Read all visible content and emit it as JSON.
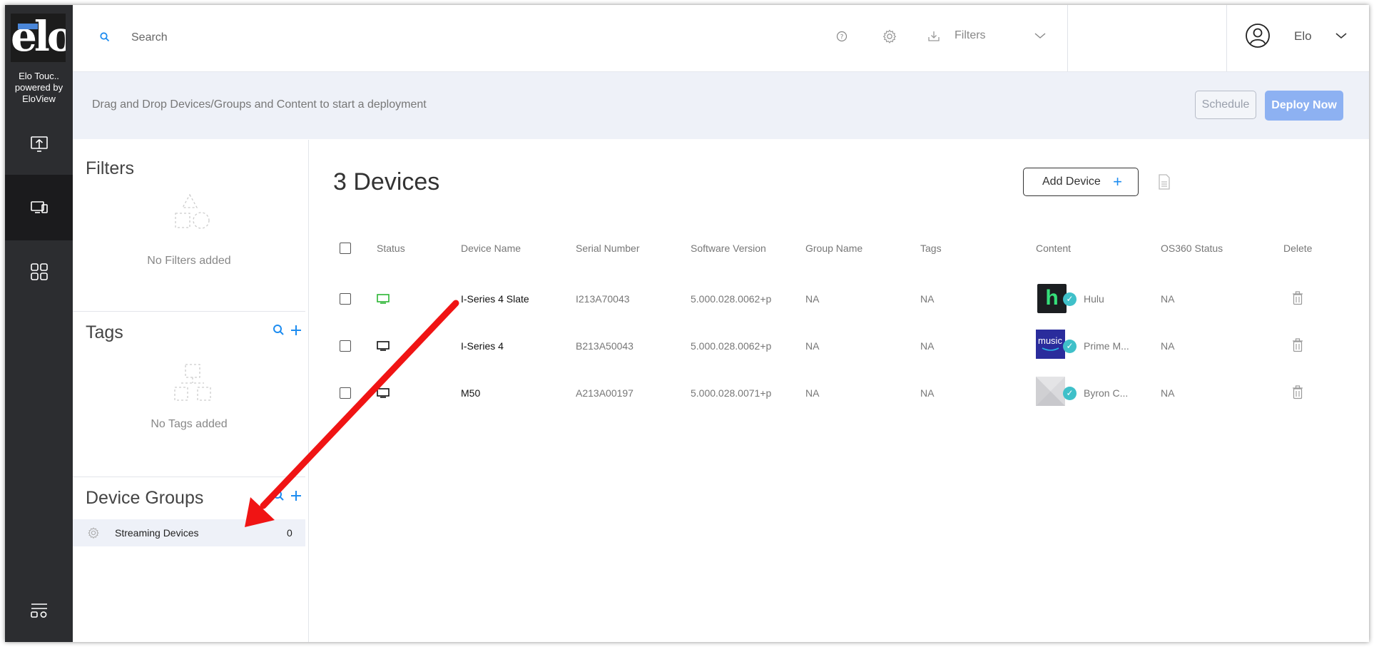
{
  "sidebar": {
    "logo_text": "elo",
    "org_name_line1": "Elo Touc..",
    "org_name_line2": "powered by",
    "org_name_line3": "EloView",
    "items": [
      {
        "icon": "upload-screen-icon"
      },
      {
        "icon": "devices-icon",
        "active": true
      },
      {
        "icon": "apps-grid-icon"
      },
      {
        "icon": "menu-settings-icon"
      }
    ]
  },
  "header": {
    "search_placeholder": "Search",
    "filters_label": "Filters",
    "user_name": "Elo"
  },
  "deploy_bar": {
    "hint": "Drag and Drop Devices/Groups and Content to start a deployment",
    "schedule_label": "Schedule",
    "deploy_label": "Deploy Now"
  },
  "left_panel": {
    "filters_title": "Filters",
    "filters_empty": "No Filters added",
    "tags_title": "Tags",
    "tags_empty": "No Tags added",
    "groups_title": "Device Groups",
    "groups": [
      {
        "name": "Streaming Devices",
        "count": "0"
      }
    ]
  },
  "main": {
    "title": "3 Devices",
    "add_device_label": "Add Device",
    "add_device_plus": "+",
    "columns": [
      "Status",
      "Device Name",
      "Serial Number",
      "Software Version",
      "Group Name",
      "Tags",
      "Content",
      "OS360 Status",
      "Delete"
    ],
    "rows": [
      {
        "status_color": "#2bb534",
        "device_name": "I-Series 4 Slate",
        "serial": "I213A70043",
        "software": "5.000.028.0062+p",
        "group": "NA",
        "tags": "NA",
        "content_thumb": "hulu",
        "content": "Hulu",
        "os360": "NA"
      },
      {
        "status_color": "#111111",
        "device_name": "I-Series 4",
        "serial": "B213A50043",
        "software": "5.000.028.0062+p",
        "group": "NA",
        "tags": "NA",
        "content_thumb": "music",
        "content": "Prime M...",
        "os360": "NA"
      },
      {
        "status_color": "#111111",
        "device_name": "M50",
        "serial": "A213A00197",
        "software": "5.000.028.0071+p",
        "group": "NA",
        "tags": "NA",
        "content_thumb": "placeholder",
        "content": "Byron C...",
        "os360": "NA"
      }
    ],
    "thumb_hulu_text": "h",
    "thumb_music_text": "music",
    "check_mark": "✓"
  },
  "colors": {
    "accent": "#1d8cf0",
    "sidebar_bg": "#2c2d30",
    "deploy_btn": "#8db1f2",
    "check_badge": "#3fc0c9",
    "annotation_arrow": "#f01414"
  }
}
